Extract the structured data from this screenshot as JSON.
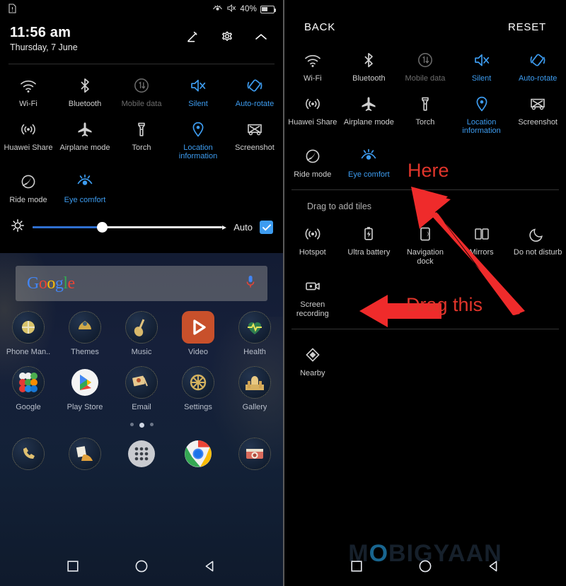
{
  "left_panel": {
    "status_bar": {
      "notification_icon": "document-icon",
      "eye_comfort_icon": "eye-comfort-icon",
      "mute_icon": "mute-icon",
      "battery_percent": "40%",
      "battery_icon": "battery-icon"
    },
    "header": {
      "time": "11:56 am",
      "date": "Thursday, 7 June",
      "icons": [
        {
          "name": "edit-icon",
          "glyph": "pencil"
        },
        {
          "name": "settings-gear-icon",
          "glyph": "gear"
        },
        {
          "name": "collapse-chevron-up-icon",
          "glyph": "chevron-up"
        }
      ]
    },
    "tiles": [
      {
        "label": "Wi-Fi",
        "icon": "wifi-icon",
        "state": "normal"
      },
      {
        "label": "Bluetooth",
        "icon": "bluetooth-icon",
        "state": "normal"
      },
      {
        "label": "Mobile data",
        "icon": "mobile-data-icon",
        "state": "disabled"
      },
      {
        "label": "Silent",
        "icon": "silent-icon",
        "state": "active"
      },
      {
        "label": "Auto-rotate",
        "icon": "auto-rotate-icon",
        "state": "active"
      },
      {
        "label": "Huawei Share",
        "icon": "huawei-share-icon",
        "state": "normal"
      },
      {
        "label": "Airplane mode",
        "icon": "airplane-icon",
        "state": "normal"
      },
      {
        "label": "Torch",
        "icon": "torch-icon",
        "state": "normal"
      },
      {
        "label": "Location information",
        "icon": "location-pin-icon",
        "state": "active"
      },
      {
        "label": "Screenshot",
        "icon": "screenshot-icon",
        "state": "normal"
      },
      {
        "label": "Ride mode",
        "icon": "ride-mode-icon",
        "state": "normal"
      },
      {
        "label": "Eye comfort",
        "icon": "eye-comfort-icon",
        "state": "active"
      }
    ],
    "brightness": {
      "icon": "brightness-icon",
      "value_percent": 36,
      "auto_label": "Auto",
      "auto_checked": true
    },
    "home_screen": {
      "search": {
        "logo_letters": [
          "G",
          "o",
          "o",
          "g",
          "l",
          "e"
        ],
        "mic_icon": "microphone-icon"
      },
      "app_rows": [
        [
          {
            "label": "Phone Man..",
            "icon": "phone-manager-icon"
          },
          {
            "label": "Themes",
            "icon": "themes-icon"
          },
          {
            "label": "Music",
            "icon": "music-icon"
          },
          {
            "label": "Video",
            "icon": "video-icon"
          },
          {
            "label": "Health",
            "icon": "health-icon"
          }
        ],
        [
          {
            "label": "Google",
            "icon": "google-folder-icon"
          },
          {
            "label": "Play Store",
            "icon": "play-store-icon"
          },
          {
            "label": "Email",
            "icon": "email-icon"
          },
          {
            "label": "Settings",
            "icon": "settings-icon"
          },
          {
            "label": "Gallery",
            "icon": "gallery-icon"
          }
        ]
      ],
      "page_dots": {
        "count": 3,
        "active_index": 1
      },
      "dock": [
        {
          "label": "",
          "icon": "phone-dialer-icon"
        },
        {
          "label": "",
          "icon": "contacts-icon"
        },
        {
          "label": "",
          "icon": "app-drawer-icon"
        },
        {
          "label": "",
          "icon": "chrome-icon"
        },
        {
          "label": "",
          "icon": "camera-icon"
        }
      ]
    },
    "nav_bar": [
      {
        "name": "recents-button",
        "icon": "square-icon"
      },
      {
        "name": "home-button",
        "icon": "circle-icon"
      },
      {
        "name": "back-button",
        "icon": "triangle-back-icon"
      }
    ]
  },
  "right_panel": {
    "header": {
      "back_label": "BACK",
      "reset_label": "RESET"
    },
    "active_tiles": [
      {
        "label": "Wi-Fi",
        "icon": "wifi-icon",
        "state": "normal"
      },
      {
        "label": "Bluetooth",
        "icon": "bluetooth-icon",
        "state": "normal"
      },
      {
        "label": "Mobile data",
        "icon": "mobile-data-icon",
        "state": "disabled"
      },
      {
        "label": "Silent",
        "icon": "silent-icon",
        "state": "active"
      },
      {
        "label": "Auto-rotate",
        "icon": "auto-rotate-icon",
        "state": "active"
      },
      {
        "label": "Huawei Share",
        "icon": "huawei-share-icon",
        "state": "normal"
      },
      {
        "label": "Airplane mode",
        "icon": "airplane-icon",
        "state": "normal"
      },
      {
        "label": "Torch",
        "icon": "torch-icon",
        "state": "normal"
      },
      {
        "label": "Location information",
        "icon": "location-pin-icon",
        "state": "active"
      },
      {
        "label": "Screenshot",
        "icon": "screenshot-icon",
        "state": "normal"
      },
      {
        "label": "Ride mode",
        "icon": "ride-mode-icon",
        "state": "normal"
      },
      {
        "label": "Eye comfort",
        "icon": "eye-comfort-icon",
        "state": "active"
      }
    ],
    "drag_section_title": "Drag to add tiles",
    "available_tiles": [
      {
        "label": "Hotspot",
        "icon": "hotspot-icon"
      },
      {
        "label": "Ultra battery",
        "icon": "ultra-battery-icon"
      },
      {
        "label": "Navigation dock",
        "icon": "navigation-dock-icon"
      },
      {
        "label": "Mirrors",
        "icon": "mirrors-icon"
      },
      {
        "label": "Do not disturb",
        "icon": "moon-icon"
      },
      {
        "label": "Screen recording",
        "icon": "screen-recording-icon"
      }
    ],
    "extra_tiles": [
      {
        "label": "Nearby",
        "icon": "nearby-icon"
      }
    ],
    "annotations": [
      {
        "text": "Here",
        "color": "#e0352b"
      },
      {
        "text": "Drag this",
        "color": "#e0352b"
      }
    ],
    "watermark": {
      "prefix": "M",
      "o": "O",
      "suffix": "BIGYAAN"
    },
    "nav_bar": [
      {
        "name": "recents-button",
        "icon": "square-icon"
      },
      {
        "name": "home-button",
        "icon": "circle-icon"
      },
      {
        "name": "back-button",
        "icon": "triangle-back-icon"
      }
    ]
  },
  "colors": {
    "accent_blue": "#3d9cf0",
    "annotation_red": "#e0352b",
    "panel_background": "#000000",
    "wallpaper": "#16203a"
  }
}
